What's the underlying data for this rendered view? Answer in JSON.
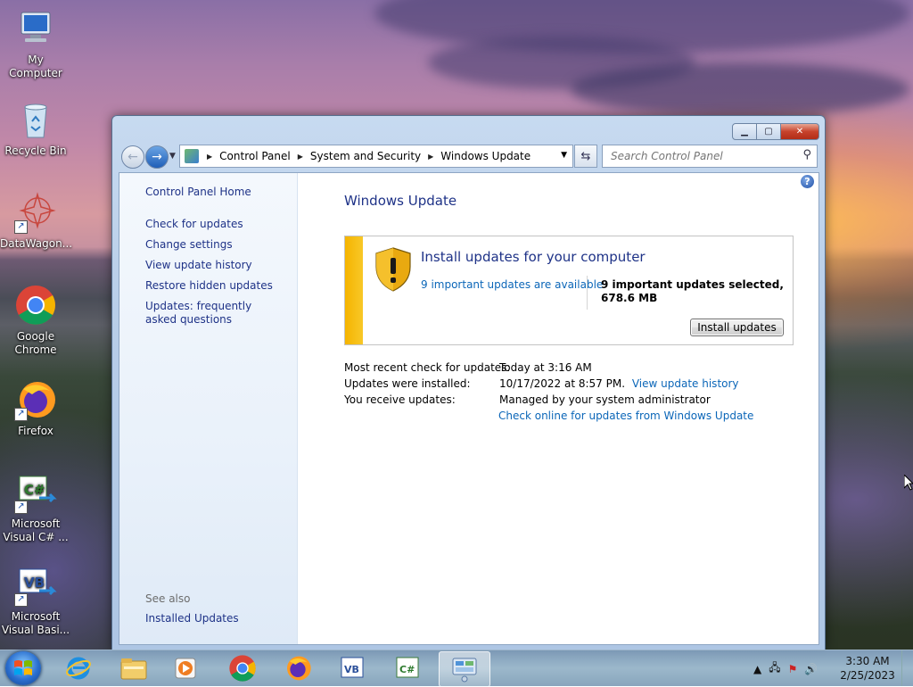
{
  "desktop": {
    "icons": [
      {
        "label": "My Computer",
        "icon": "computer-icon"
      },
      {
        "label": "Recycle Bin",
        "icon": "recycle-bin-icon"
      },
      {
        "label": "DataWagon...",
        "icon": "datawagon-icon"
      },
      {
        "label": "Google Chrome",
        "icon": "chrome-icon"
      },
      {
        "label": "Firefox",
        "icon": "firefox-icon"
      },
      {
        "label": "Microsoft Visual C# ...",
        "icon": "visual-csharp-icon"
      },
      {
        "label": "Microsoft Visual Basi...",
        "icon": "visual-basic-icon"
      }
    ]
  },
  "window": {
    "breadcrumb": [
      "Control Panel",
      "System and Security",
      "Windows Update"
    ],
    "search_placeholder": "Search Control Panel",
    "help_glyph": "?"
  },
  "sidebar": {
    "home": "Control Panel Home",
    "links": [
      "Check for updates",
      "Change settings",
      "View update history",
      "Restore hidden updates",
      "Updates: frequently asked questions"
    ],
    "see_also": "See also",
    "see_also_links": [
      "Installed Updates"
    ]
  },
  "main": {
    "title": "Windows Update",
    "update_box": {
      "title": "Install updates for your computer",
      "available_link": "9 important updates are available",
      "selected_text": "9 important updates selected, 678.6 MB",
      "install_button": "Install updates",
      "accent_color": "#f5b400"
    },
    "info": {
      "recent_check_label": "Most recent check for updates:",
      "recent_check_value": "Today at 3:16 AM",
      "installed_label": "Updates were installed:",
      "installed_value": "10/17/2022 at 8:57 PM.",
      "history_link": "View update history",
      "receive_label": "You receive updates:",
      "receive_value": "Managed by your system administrator",
      "online_link": "Check online for updates from Windows Update"
    }
  },
  "taskbar": {
    "items": [
      "internet-explorer-icon",
      "explorer-folder-icon",
      "media-player-icon",
      "chrome-icon",
      "firefox-icon",
      "visual-basic-icon",
      "visual-csharp-icon",
      "control-panel-icon"
    ],
    "clock_time": "3:30 AM",
    "clock_date": "2/25/2023"
  }
}
